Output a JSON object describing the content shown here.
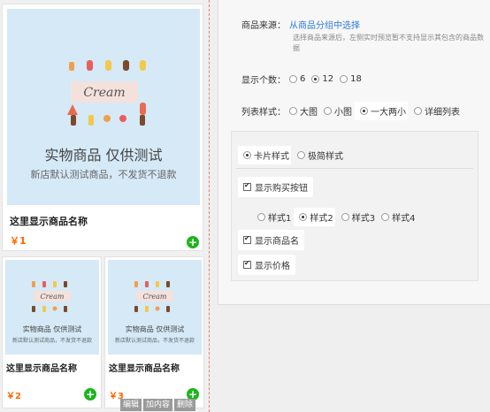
{
  "preview": {
    "image": {
      "cream_text": "Cream",
      "caption_title": "实物商品 仅供测试",
      "caption_sub": "新店默认测试商品，不发货不退款"
    },
    "items": [
      {
        "name": "这里显示商品名称",
        "price": "￥1"
      },
      {
        "name": "这里显示商品名称",
        "price": "￥2"
      },
      {
        "name": "这里显示商品名称",
        "price": "￥3"
      }
    ],
    "buy_icon": "+",
    "edit_actions": [
      "编辑",
      "加内容",
      "删除"
    ]
  },
  "panel": {
    "source_label": "商品来源：",
    "source_link": "从商品分组中选择",
    "source_hint": "选择商品来源后，左侧实时预览暂不支持显示其包含的商品数据",
    "count_label": "显示个数：",
    "count_options": [
      "6",
      "12",
      "18"
    ],
    "count_selected": "12",
    "list_label": "列表样式：",
    "list_options": [
      "大图",
      "小图",
      "一大两小",
      "详细列表"
    ],
    "list_selected": "一大两小",
    "card_options": [
      "卡片样式",
      "极简样式"
    ],
    "card_selected": "卡片样式",
    "show_buy_label": "显示购买按钮",
    "buy_style_options": [
      "样式1",
      "样式2",
      "样式3",
      "样式4"
    ],
    "buy_style_selected": "样式2",
    "show_name_label": "显示商品名",
    "show_price_label": "显示价格"
  },
  "colors": {
    "accent_link": "#2e7bd6",
    "price": "#ff6600",
    "buy_button": "#1cb51c",
    "image_bg": "#d5e9f7"
  }
}
